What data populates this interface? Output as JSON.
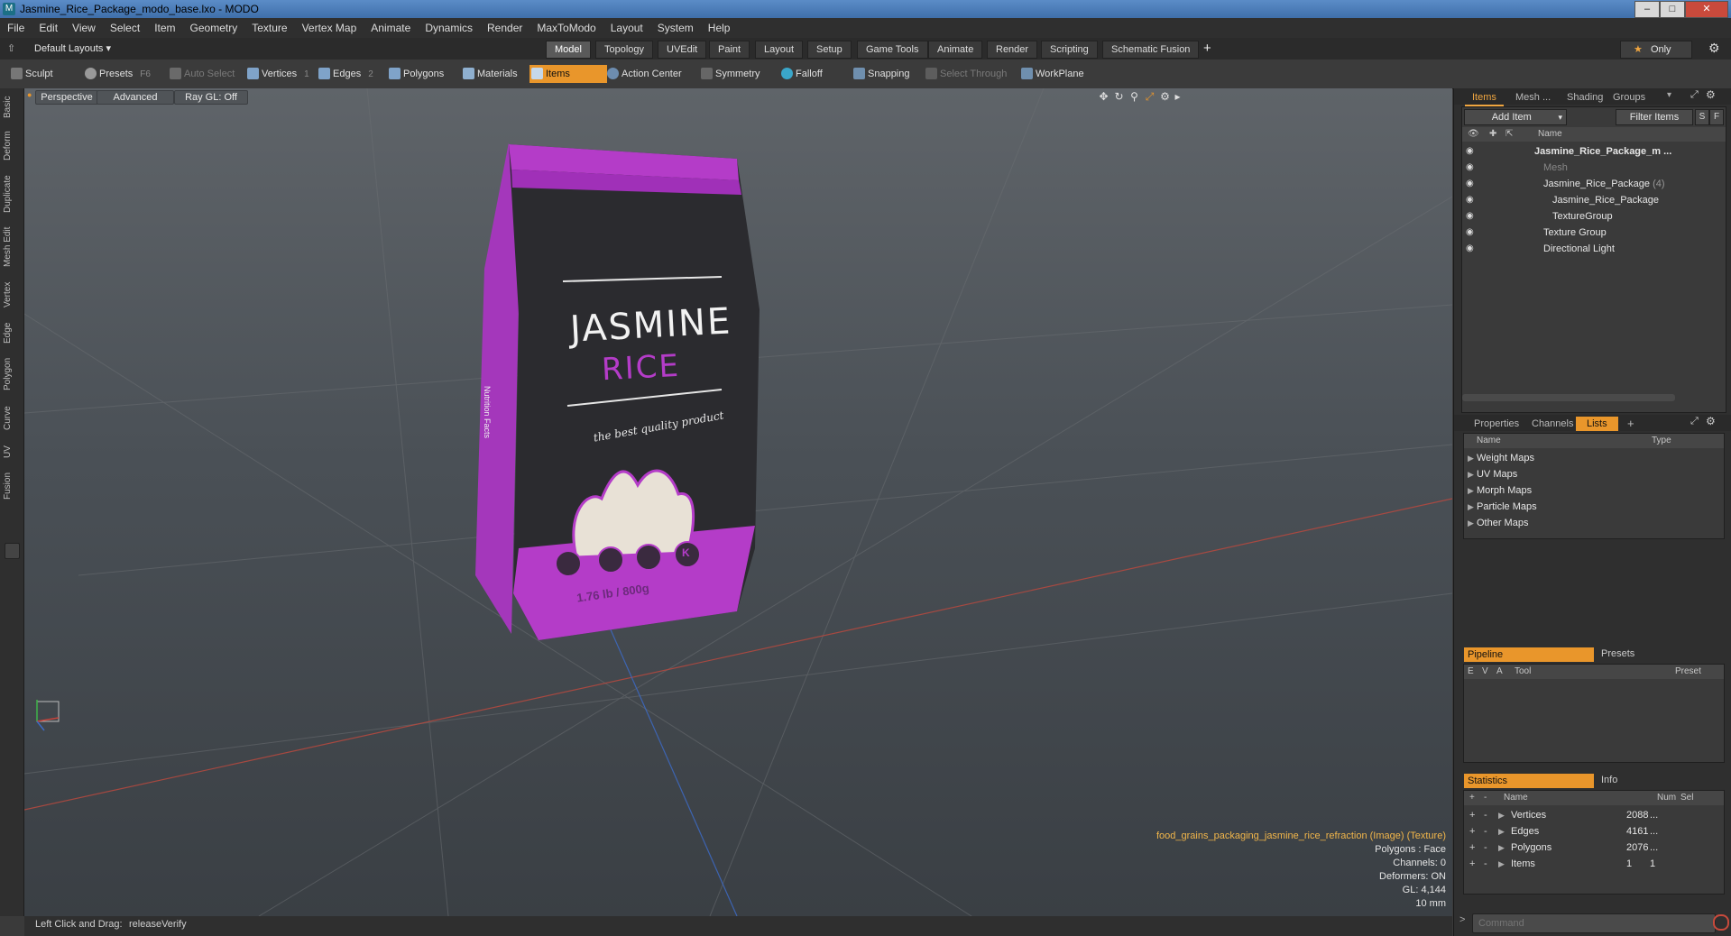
{
  "window": {
    "title": "Jasmine_Rice_Package_modo_base.lxo - MODO",
    "controls": [
      "–",
      "□",
      "✕"
    ]
  },
  "menubar": [
    "File",
    "Edit",
    "View",
    "Select",
    "Item",
    "Geometry",
    "Texture",
    "Vertex Map",
    "Animate",
    "Dynamics",
    "Render",
    "MaxToModo",
    "Layout",
    "System",
    "Help"
  ],
  "layoutbar": {
    "layout_selector": "Default Layouts ▾",
    "tabs": [
      "Model",
      "Topology",
      "UVEdit",
      "Paint",
      "Layout",
      "Setup",
      "Game Tools",
      "Animate",
      "Render",
      "Scripting",
      "Schematic Fusion"
    ],
    "active_tab": "Model",
    "add": "+",
    "only_label": "Only"
  },
  "toolbar": {
    "sculpt": "Sculpt",
    "presets": "Presets",
    "presets_key": "F6",
    "auto_select": "Auto Select",
    "vertices": "Vertices",
    "vertices_count": "1",
    "edges": "Edges",
    "edges_count": "2",
    "polygons": "Polygons",
    "materials": "Materials",
    "items": "Items",
    "action_center": "Action Center",
    "symmetry": "Symmetry",
    "falloff": "Falloff",
    "snapping": "Snapping",
    "select_through": "Select Through",
    "workplane": "WorkPlane"
  },
  "left_tabs": [
    "Basic",
    "Deform",
    "Duplicate",
    "Mesh Edit",
    "Vertex",
    "Edge",
    "Polygon",
    "Curve",
    "UV",
    "Fusion"
  ],
  "viewport": {
    "view_mode": "Perspective",
    "shading": "Advanced",
    "raygl": "Ray GL: Off",
    "info_lines": {
      "texture": "food_grains_packaging_jasmine_rice_refraction (Image) (Texture)",
      "polygons": "Polygons : Face",
      "channels": "Channels: 0",
      "deformers": "Deformers: ON",
      "gl": "GL: 4,144",
      "scale": "10 mm"
    },
    "package": {
      "brand_line1": "JASMINE",
      "brand_line2": "RICE",
      "tagline": "the best quality product",
      "weight": "1.76 lb / 800g",
      "side_text": "Nutrition Facts",
      "badge_k": "K"
    }
  },
  "statusbar": {
    "hint_label": "Left Click and Drag:",
    "hint_value": "releaseVerify"
  },
  "items_panel": {
    "tabs": [
      "Items",
      "Mesh ...",
      "Shading",
      "Groups"
    ],
    "add_item": "Add Item",
    "filter_items": "Filter Items",
    "s": "S",
    "f": "F",
    "name_header": "Name",
    "tree": [
      {
        "label": "Jasmine_Rice_Package_m ...",
        "indent": 0,
        "bold": true
      },
      {
        "label": "Mesh",
        "indent": 1,
        "dim": true
      },
      {
        "label": "Jasmine_Rice_Package",
        "suffix": "(4)",
        "indent": 1
      },
      {
        "label": "Jasmine_Rice_Package",
        "indent": 2
      },
      {
        "label": "TextureGroup",
        "indent": 2
      },
      {
        "label": "Texture Group",
        "indent": 1
      },
      {
        "label": "Directional Light",
        "indent": 1
      }
    ]
  },
  "lists_panel": {
    "tabs": [
      "Properties",
      "Channels",
      "Lists",
      "+"
    ],
    "active_tab": "Lists",
    "headers": [
      "Name",
      "Type"
    ],
    "rows": [
      "Weight Maps",
      "UV Maps",
      "Morph Maps",
      "Particle Maps",
      "Other Maps"
    ]
  },
  "pipeline_panel": {
    "tabs": [
      "Pipeline",
      "Presets"
    ],
    "headers": [
      "E",
      "V",
      "A",
      "Tool",
      "Preset"
    ]
  },
  "stats_panel": {
    "tabs": [
      "Statistics",
      "Info"
    ],
    "headers": [
      "Name",
      "Num",
      "Sel"
    ],
    "rows": [
      {
        "name": "Vertices",
        "num": "2088",
        "sel": "..."
      },
      {
        "name": "Edges",
        "num": "4161",
        "sel": "..."
      },
      {
        "name": "Polygons",
        "num": "2076",
        "sel": "..."
      },
      {
        "name": "Items",
        "num": "1",
        "sel": "1"
      }
    ]
  },
  "command": {
    "placeholder": "Command"
  },
  "colors": {
    "accent": "#e9962b",
    "package_purple": "#b43cc8",
    "package_dark": "#2a2a2d"
  }
}
